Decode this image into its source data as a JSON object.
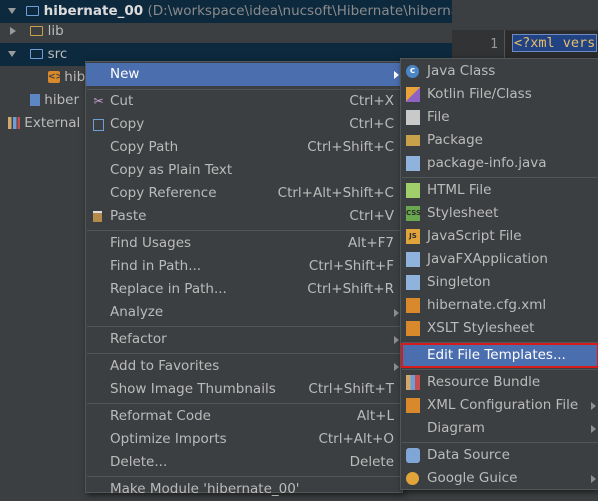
{
  "tree": {
    "root_name": "hibernate_00",
    "root_path": "(D:\\workspace\\idea\\nucsoft\\Hibernate\\hibernate",
    "lib": "lib",
    "src": "src",
    "src_child": "hib",
    "module_item": "hiber",
    "external": "External L"
  },
  "editor": {
    "line_number": "1",
    "code_line": "<?xml vers"
  },
  "context_menu": {
    "items": [
      {
        "label": "New"
      },
      {
        "label": "Cut",
        "shortcut": "Ctrl+X"
      },
      {
        "label": "Copy",
        "shortcut": "Ctrl+C"
      },
      {
        "label": "Copy Path",
        "shortcut": "Ctrl+Shift+C"
      },
      {
        "label": "Copy as Plain Text"
      },
      {
        "label": "Copy Reference",
        "shortcut": "Ctrl+Alt+Shift+C"
      },
      {
        "label": "Paste",
        "shortcut": "Ctrl+V"
      },
      {
        "label": "Find Usages",
        "shortcut": "Alt+F7"
      },
      {
        "label": "Find in Path...",
        "shortcut": "Ctrl+Shift+F"
      },
      {
        "label": "Replace in Path...",
        "shortcut": "Ctrl+Shift+R"
      },
      {
        "label": "Analyze"
      },
      {
        "label": "Refactor"
      },
      {
        "label": "Add to Favorites"
      },
      {
        "label": "Show Image Thumbnails",
        "shortcut": "Ctrl+Shift+T"
      },
      {
        "label": "Reformat Code",
        "shortcut": "Alt+L"
      },
      {
        "label": "Optimize Imports",
        "shortcut": "Ctrl+Alt+O"
      },
      {
        "label": "Delete...",
        "shortcut": "Delete"
      },
      {
        "label": "Make Module 'hibernate_00'"
      }
    ]
  },
  "new_submenu": {
    "items": [
      {
        "label": "Java Class"
      },
      {
        "label": "Kotlin File/Class"
      },
      {
        "label": "File"
      },
      {
        "label": "Package"
      },
      {
        "label": "package-info.java"
      },
      {
        "label": "HTML File"
      },
      {
        "label": "Stylesheet"
      },
      {
        "label": "JavaScript File"
      },
      {
        "label": "JavaFXApplication"
      },
      {
        "label": "Singleton"
      },
      {
        "label": "hibernate.cfg.xml"
      },
      {
        "label": "XSLT Stylesheet"
      },
      {
        "label": "Edit File Templates..."
      },
      {
        "label": "Resource Bundle"
      },
      {
        "label": "XML Configuration File"
      },
      {
        "label": "Diagram"
      },
      {
        "label": "Data Source"
      },
      {
        "label": "Google Guice"
      }
    ]
  },
  "colors": {
    "selection": "#4b6eaf",
    "highlight_box": "#d71a1a",
    "menu_bg": "#3c3f41",
    "editor_bg": "#2b2b2b"
  }
}
